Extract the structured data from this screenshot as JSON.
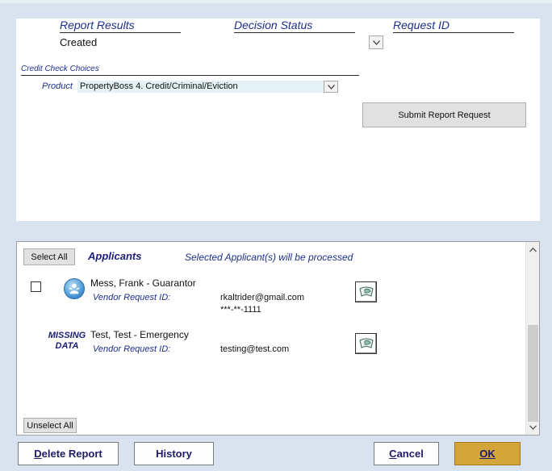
{
  "report_section": {
    "report_results_header": "Report Results",
    "decision_status_header": "Decision Status",
    "request_id_header": "Request ID",
    "report_results_value": "Created"
  },
  "credit_check": {
    "section_label": "Credit Check Choices",
    "product_label": "Product",
    "product_value": "PropertyBoss 4. Credit/Criminal/Eviction"
  },
  "submit_button_label": "Submit Report Request",
  "applicants_section": {
    "select_all_label": "Select All",
    "title": "Applicants",
    "note": "Selected Applicant(s) will be processed",
    "unselect_all_label": "Unselect All",
    "items": [
      {
        "name": "Mess, Frank   - Guarantor",
        "vendor_label": "Vendor Request ID:",
        "email": "rkaltrider@gmail.com",
        "ssn": "***-**-1111",
        "checked": false
      },
      {
        "missing_line1": "MISSING",
        "missing_line2": "DATA",
        "name": "Test, Test  - Emergency",
        "vendor_label": "Vendor Request ID:",
        "email": "testing@test.com"
      }
    ]
  },
  "footer": {
    "delete_first": "D",
    "delete_rest": "elete Report",
    "history_label": "History",
    "cancel_first": "C",
    "cancel_rest": "ancel",
    "ok_label": "OK"
  },
  "colors": {
    "background": "#d9e3ef",
    "label_blue": "#1c2f8a",
    "ok_button": "#d4a53a",
    "product_field": "#e4f2f3"
  },
  "icons": [
    "chevron-down-icon",
    "chevron-up-icon",
    "person-icon",
    "document-icon"
  ]
}
